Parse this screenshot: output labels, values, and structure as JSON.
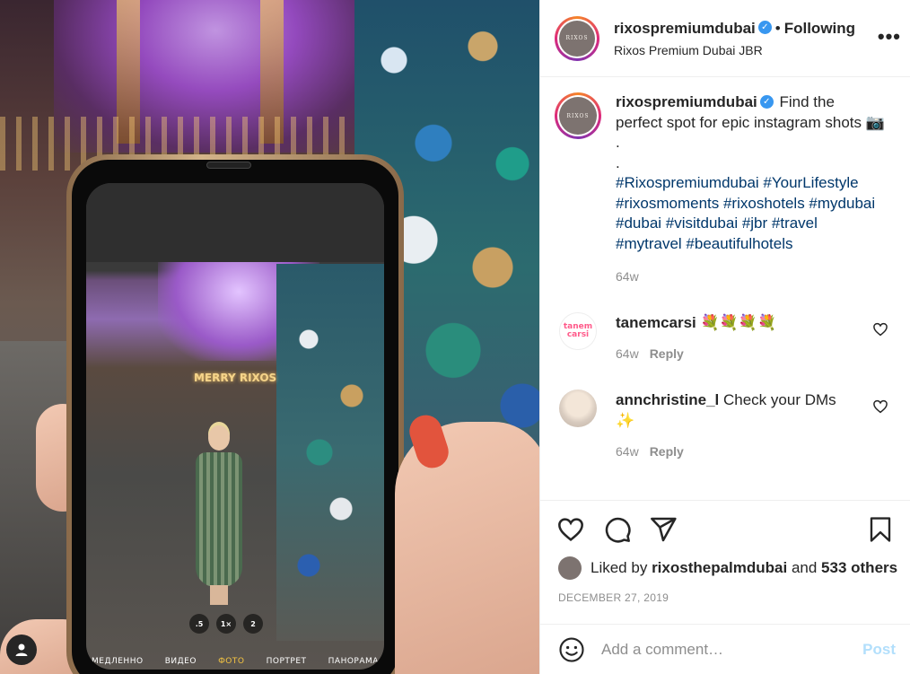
{
  "photo": {
    "phone_sign_text": "MERRY RIXOS",
    "zoom_levels": [
      ".5",
      "1×",
      "2"
    ],
    "camera_modes": [
      "МЕДЛЕННО",
      "ВИДЕО",
      "ФОТО",
      "ПОРТРЕТ",
      "ПАНОРАМА"
    ],
    "active_mode": "ФОТО"
  },
  "header": {
    "username": "rixospremiumdubai",
    "verified": "✓",
    "separator": "•",
    "follow_status": "Following",
    "location": "Rixos Premium Dubai JBR",
    "more_label": "•••",
    "avatar_logo_text": "RIXOS"
  },
  "caption": {
    "username": "rixospremiumdubai",
    "text": "Find the perfect spot for epic instagram shots 📷",
    "dots": [
      ".",
      "."
    ],
    "hashtags": "#Rixospremiumdubai #YourLifestyle #rixosmoments #rixoshotels #mydubai #dubai #visitdubai #jbr #travel #mytravel #beautifulhotels",
    "time": "64w"
  },
  "comments": [
    {
      "username": "tanemcarsi",
      "text": "💐💐💐💐",
      "time": "64w",
      "reply": "Reply",
      "avatar_text": "tanem carsi",
      "avatar_color": "#ff5a8a"
    },
    {
      "username": "annchristine_l",
      "text": "Check your DMs ✨",
      "time": "64w",
      "reply": "Reply",
      "avatar_text": "",
      "avatar_color": "#d8cbbf"
    }
  ],
  "likes": {
    "prefix": "Liked by",
    "user": "rixosthepalmdubai",
    "conj": "and",
    "others": "533 others"
  },
  "date": "DECEMBER 27, 2019",
  "add_comment": {
    "placeholder": "Add a comment…",
    "post_label": "Post"
  },
  "colors": {
    "link": "#00376b",
    "verified": "#3897f0",
    "muted": "#8e8e8e",
    "post_disabled": "#b2dffc"
  }
}
